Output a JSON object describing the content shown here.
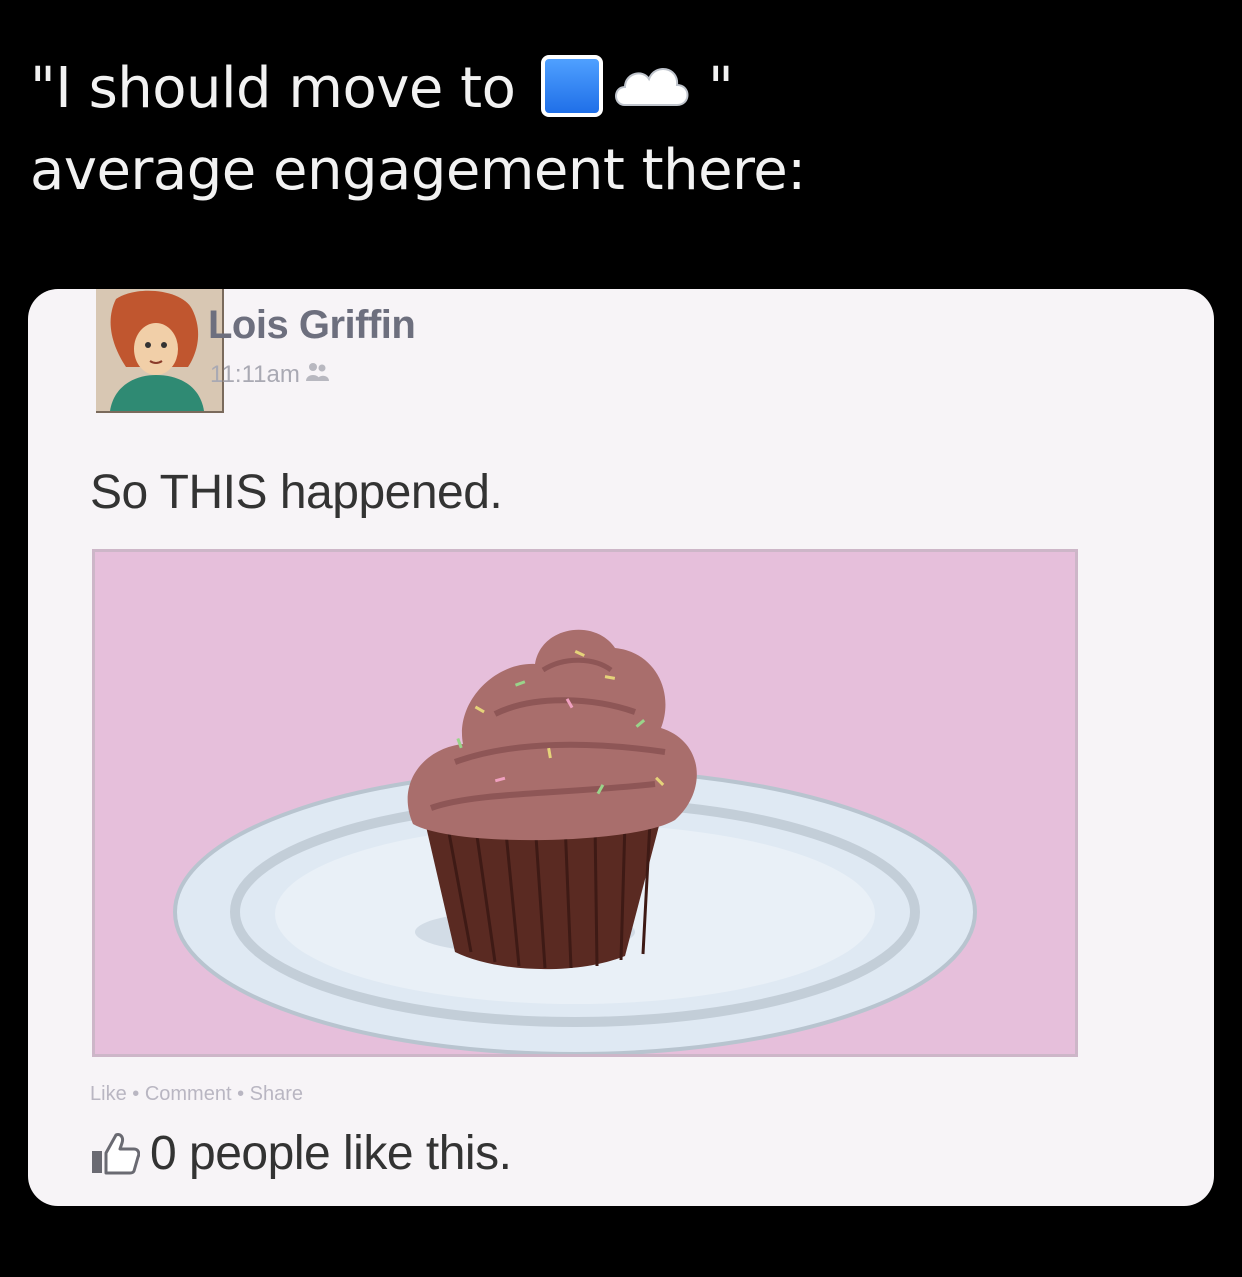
{
  "caption": {
    "line1_prefix": "\"I should move to",
    "line1_suffix": "\"",
    "line2": "average engagement there:",
    "emojis": [
      "blue-square-icon",
      "cloud-icon"
    ]
  },
  "post": {
    "author": "Lois Griffin",
    "timestamp": "11:11am",
    "text": "So THIS happened.",
    "actions": {
      "like": "Like",
      "separator": " • ",
      "comment": "Comment",
      "share": "Share"
    },
    "likes_text": "0 people like this.",
    "image_subject": "cupcake-on-plate"
  },
  "colors": {
    "background": "#000000",
    "card": "#f7f4f7",
    "image_bg": "#e6bfdb",
    "name": "#6d6f7e"
  }
}
